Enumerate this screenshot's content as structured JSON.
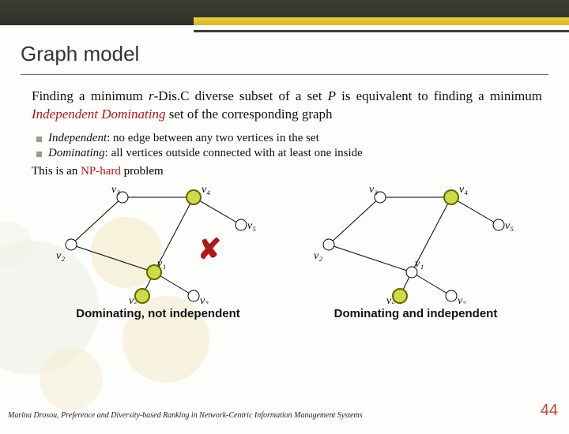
{
  "slide": {
    "title": "Graph model",
    "paragraph_pre": "Finding a minimum ",
    "paragraph_r": "r",
    "paragraph_disc": "-Dis.C diverse subset of a set ",
    "paragraph_P": "P",
    "paragraph_mid": " is equivalent to finding a minimum ",
    "paragraph_redterm": "Independent Dominating",
    "paragraph_post": " set of the corresponding graph",
    "bullet1_kw": "Independent",
    "bullet1_rest": ": no edge between any two vertices in the set",
    "bullet2_kw": "Dominating",
    "bullet2_rest": ": all vertices outside connected with at least one inside",
    "np_pre": "This is an ",
    "np_hard": "NP-hard",
    "np_post": " problem",
    "caption_left": "Dominating, not independent",
    "caption_right": "Dominating and independent",
    "cross": "✘"
  },
  "footer": {
    "reference": "Marina Drosou, Preference and Diversity-based Ranking in Network-Centric Information Management Systems",
    "page": "44"
  },
  "graph": {
    "vertices": [
      "v1",
      "v2",
      "v3",
      "v4",
      "v5",
      "v6",
      "v7"
    ],
    "edges": [
      [
        "v1",
        "v2"
      ],
      [
        "v2",
        "v3"
      ],
      [
        "v3",
        "v4"
      ],
      [
        "v4",
        "v5"
      ],
      [
        "v1",
        "v4"
      ],
      [
        "v1",
        "v6"
      ],
      [
        "v1",
        "v7"
      ]
    ],
    "left_selected": [
      "v1",
      "v4",
      "v6"
    ],
    "right_selected": [
      "v4",
      "v6"
    ]
  }
}
